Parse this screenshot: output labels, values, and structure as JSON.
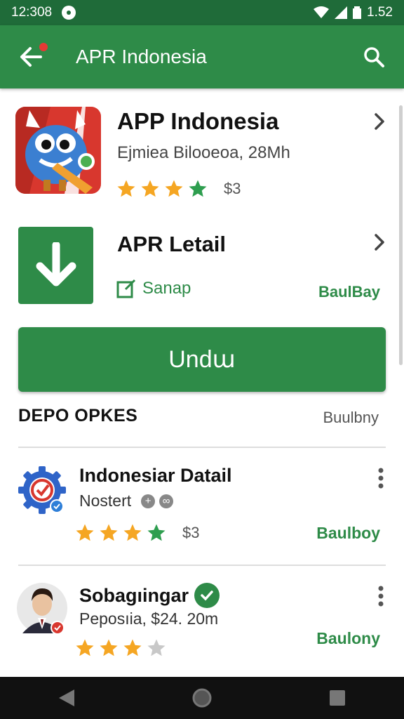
{
  "status_bar": {
    "time": "12:308",
    "battery_text": "1.52"
  },
  "app_bar": {
    "title": "APR Indonesia"
  },
  "featured_app": {
    "title": "APP Indonesia",
    "subtitle": "Ejmiea Bilooeoa, 28Mh",
    "rating": 4,
    "price": "$3"
  },
  "detail": {
    "title": "APR Letail",
    "action_label": "Sanap",
    "link_label": "BaulBay"
  },
  "install_button": {
    "label": "Undա"
  },
  "section": {
    "title": "DEPO OPKES",
    "link": "Buulbny"
  },
  "list": [
    {
      "title": "Indonesiar Datail",
      "subtitle": "Nostert",
      "rating": 4,
      "price": "$3",
      "link": "Baulboy"
    },
    {
      "title": "Sobagıingar",
      "subtitle": "Peposıia, $24. 20m",
      "rating": 3,
      "link": "Baulony"
    }
  ],
  "colors": {
    "primary": "#2e8b48",
    "status_bar": "#1f6b39",
    "star": "#f5a623",
    "star_green": "#2e9e4f"
  }
}
